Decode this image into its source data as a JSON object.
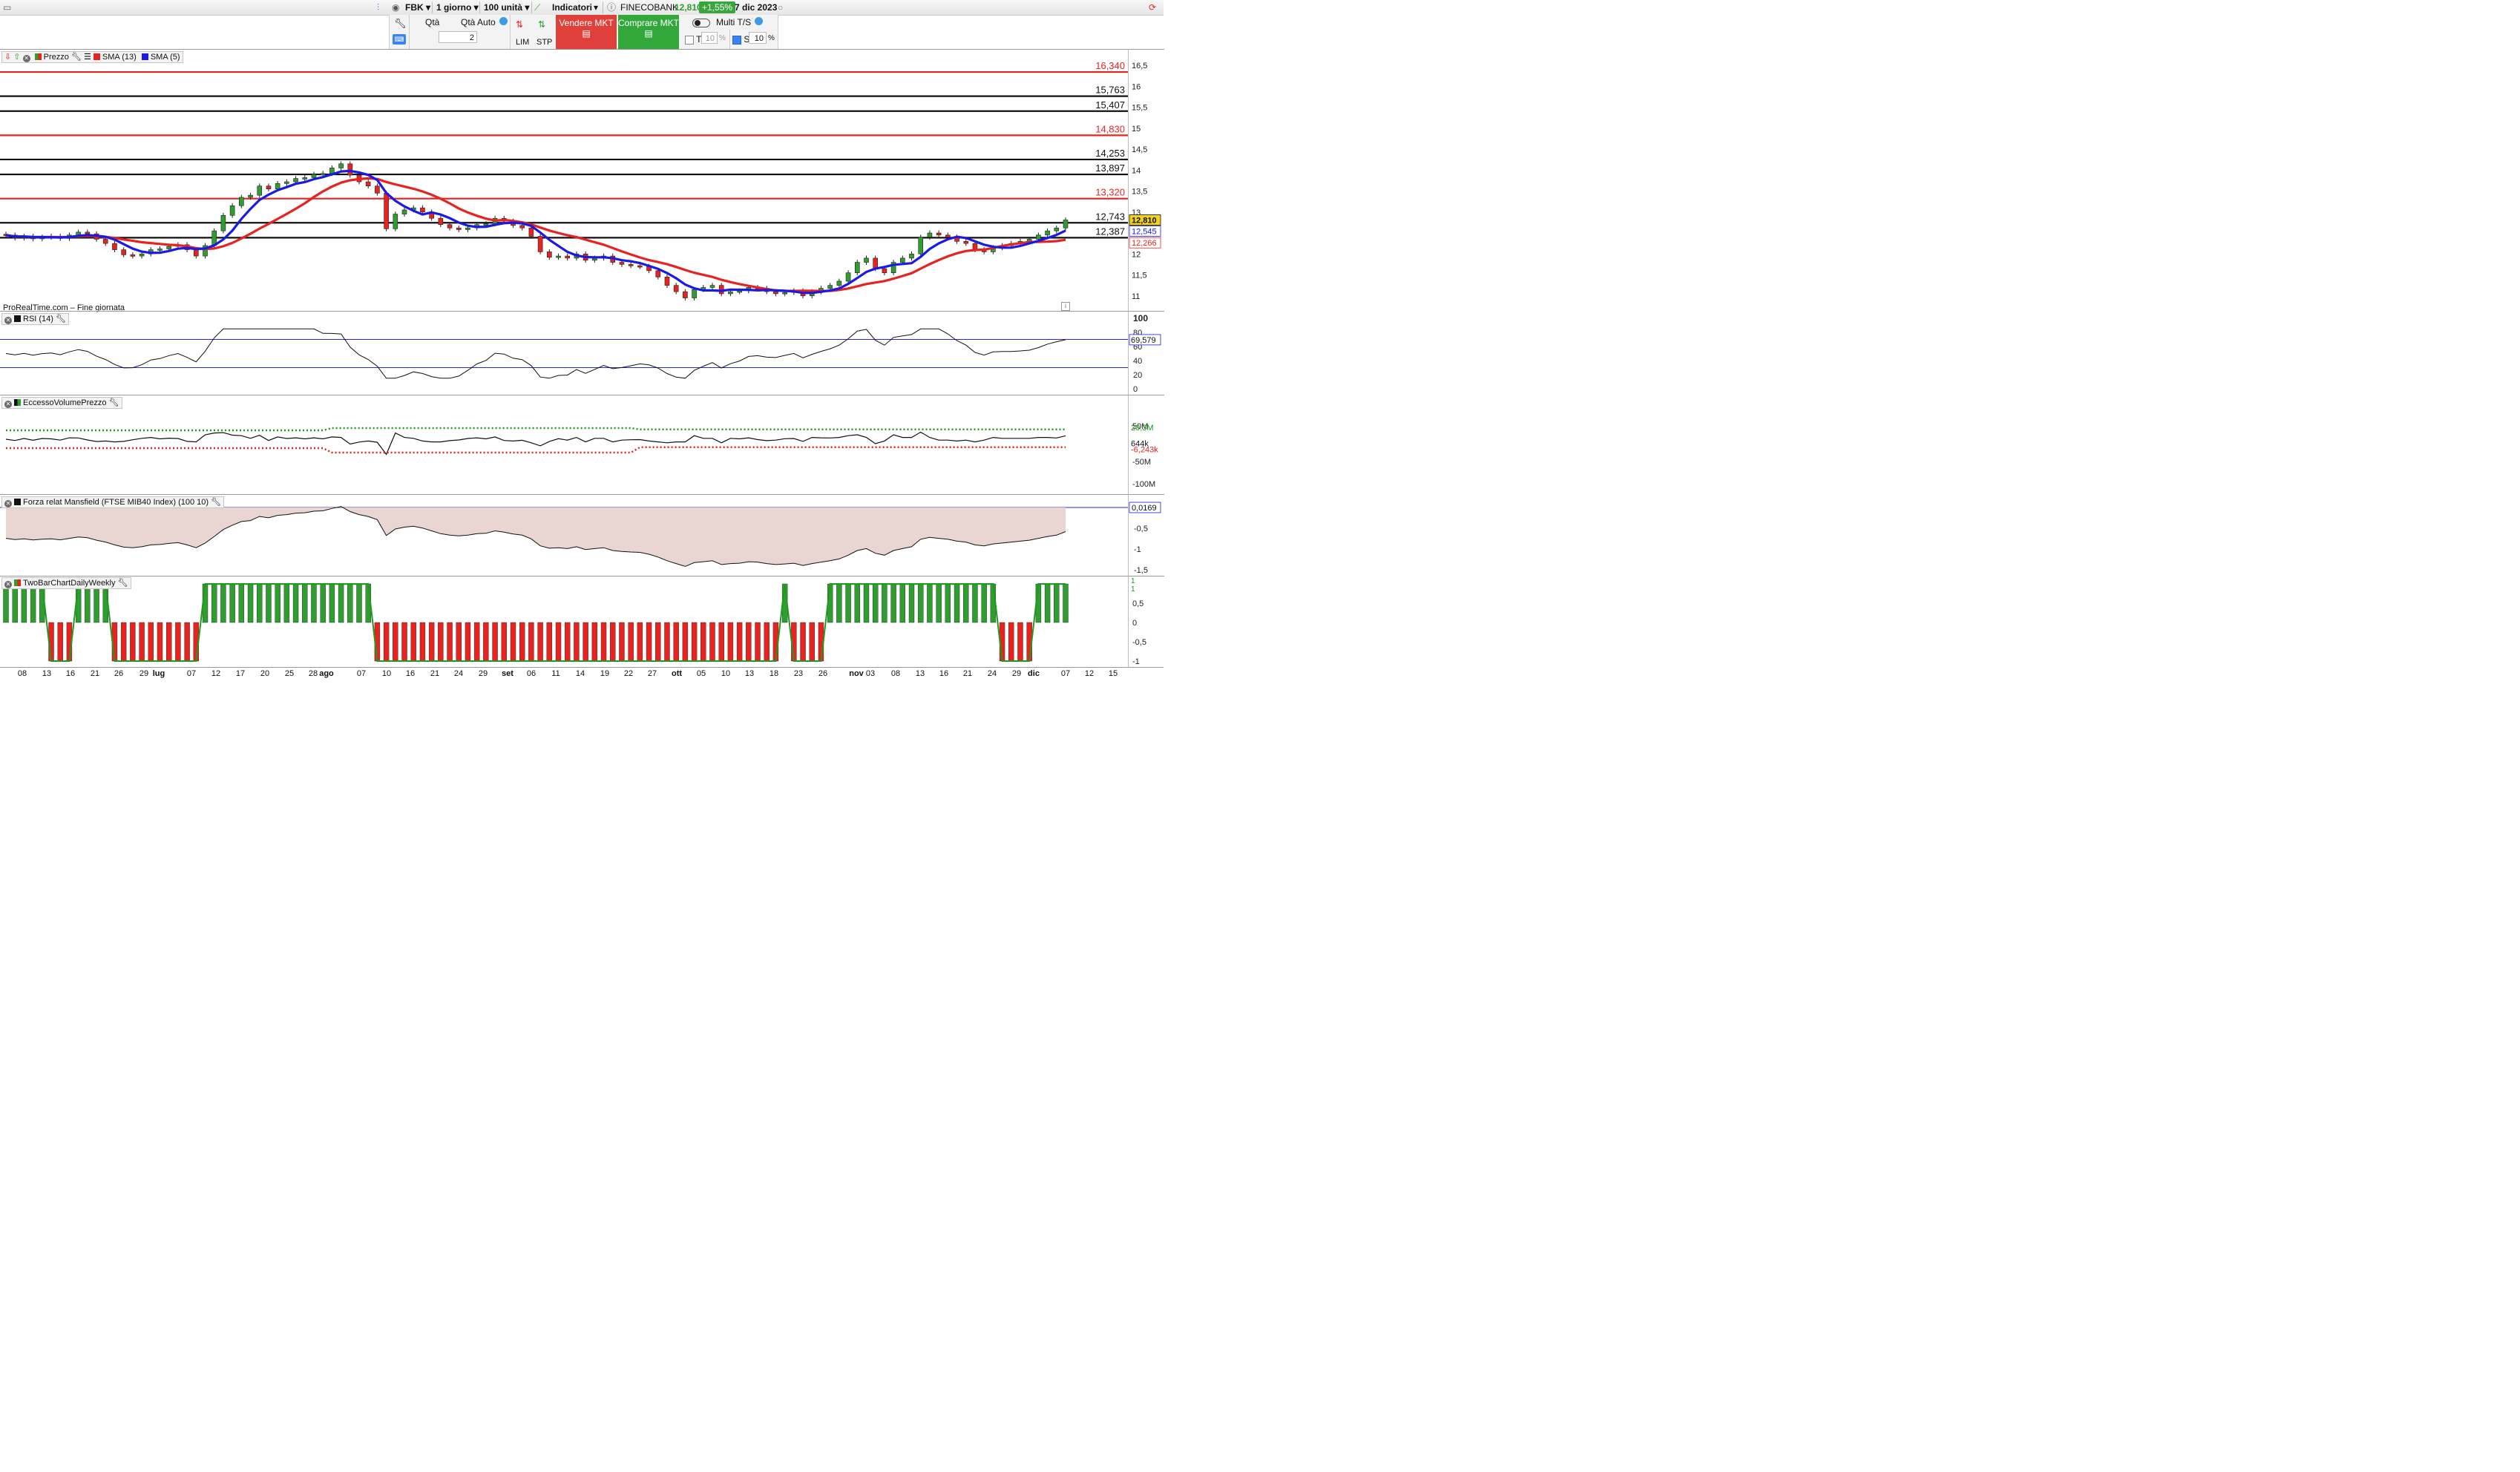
{
  "topbar": {
    "symbol": "FBK",
    "period": "1 giorno",
    "units": "100 unità",
    "indicators": "Indicatori",
    "instrument": "FINECOBANK",
    "last_price": "12,810",
    "change": "+1,55%",
    "date": "7 dic 2023"
  },
  "order_panel": {
    "qty_label": "Qtà",
    "qty_auto_label": "Qtà Auto",
    "qty_value": "2",
    "lim": "LIM",
    "stp": "STP",
    "sell": "Vendere MKT",
    "buy": "Comprare MKT",
    "multi_ts": "Multi T/S",
    "t_label": "T",
    "t_value": "10",
    "s_label": "S",
    "s_value": "10",
    "pct": "%"
  },
  "price_panel": {
    "header_title": "Prezzo",
    "sma13_label": "SMA (13)",
    "sma5_label": "SMA (5)",
    "footer": "ProRealTime.com – Fine giornata",
    "levels": [
      {
        "value": "16,340",
        "color": "#e8231f"
      },
      {
        "value": "15,763",
        "color": "#111111"
      },
      {
        "value": "15,407",
        "color": "#111111"
      },
      {
        "value": "14,830",
        "color": "#e8231f"
      },
      {
        "value": "14,253",
        "color": "#111111"
      },
      {
        "value": "13,897",
        "color": "#111111"
      },
      {
        "value": "13,320",
        "color": "#e8231f"
      },
      {
        "value": "12,743",
        "color": "#111111"
      },
      {
        "value": "12,387",
        "color": "#111111"
      }
    ],
    "y_ticks": [
      "16,5",
      "16",
      "15,5",
      "15",
      "14,5",
      "14",
      "13,5",
      "13",
      "12",
      "11,5",
      "11"
    ],
    "tags": {
      "price": "12,810",
      "sma5": "12,545",
      "sma13": "12,266"
    }
  },
  "rsi_panel": {
    "header_title": "RSI (14)",
    "y_ticks": [
      "100",
      "80",
      "60",
      "40",
      "20",
      "0"
    ],
    "value": "69,579"
  },
  "evp_panel": {
    "header_title": "EccessoVolumePrezzo",
    "y_ticks": [
      "50M",
      "-50M",
      "-100M"
    ],
    "upper_value": "20,3M",
    "value": "644k",
    "lower_value": "-6,243k"
  },
  "mansfield_panel": {
    "header_title": "Forza relat Mansfield (FTSE MIB40 Index) (100 10)",
    "y_ticks": [
      "-0,5",
      "-1",
      "-1,5"
    ],
    "value": "0,0169"
  },
  "twobar_panel": {
    "header_title": "TwoBarChartDailyWeekly",
    "y_ticks": [
      "0,5",
      "0",
      "-0,5",
      "-1"
    ],
    "value_1": "1",
    "value_2": "1"
  },
  "x_axis": [
    {
      "label": "08",
      "bold": false
    },
    {
      "label": "13",
      "bold": false
    },
    {
      "label": "16",
      "bold": false
    },
    {
      "label": "21",
      "bold": false
    },
    {
      "label": "26",
      "bold": false
    },
    {
      "label": "29",
      "bold": false
    },
    {
      "label": "lug",
      "bold": true
    },
    {
      "label": "07",
      "bold": false
    },
    {
      "label": "12",
      "bold": false
    },
    {
      "label": "17",
      "bold": false
    },
    {
      "label": "20",
      "bold": false
    },
    {
      "label": "25",
      "bold": false
    },
    {
      "label": "28",
      "bold": false
    },
    {
      "label": "ago",
      "bold": true
    },
    {
      "label": "07",
      "bold": false
    },
    {
      "label": "10",
      "bold": false
    },
    {
      "label": "16",
      "bold": false
    },
    {
      "label": "21",
      "bold": false
    },
    {
      "label": "24",
      "bold": false
    },
    {
      "label": "29",
      "bold": false
    },
    {
      "label": "set",
      "bold": true
    },
    {
      "label": "06",
      "bold": false
    },
    {
      "label": "11",
      "bold": false
    },
    {
      "label": "14",
      "bold": false
    },
    {
      "label": "19",
      "bold": false
    },
    {
      "label": "22",
      "bold": false
    },
    {
      "label": "27",
      "bold": false
    },
    {
      "label": "ott",
      "bold": true
    },
    {
      "label": "05",
      "bold": false
    },
    {
      "label": "10",
      "bold": false
    },
    {
      "label": "13",
      "bold": false
    },
    {
      "label": "18",
      "bold": false
    },
    {
      "label": "23",
      "bold": false
    },
    {
      "label": "26",
      "bold": false
    },
    {
      "label": "nov",
      "bold": true
    },
    {
      "label": "03",
      "bold": false
    },
    {
      "label": "08",
      "bold": false
    },
    {
      "label": "13",
      "bold": false
    },
    {
      "label": "16",
      "bold": false
    },
    {
      "label": "21",
      "bold": false
    },
    {
      "label": "24",
      "bold": false
    },
    {
      "label": "29",
      "bold": false
    },
    {
      "label": "dic",
      "bold": true
    },
    {
      "label": "07",
      "bold": false
    },
    {
      "label": "12",
      "bold": false
    },
    {
      "label": "15",
      "bold": false
    }
  ],
  "colors": {
    "up": "#2e9e2e",
    "down": "#e8231f",
    "sma5": "#1a1ae6",
    "sma13": "#e8231f",
    "rsi_band": "#2a2ad0",
    "evp_upper": "#1f9a1f",
    "evp_lower": "#e8231f",
    "mansfield_fill": "#e9d6d3"
  },
  "chart_data": {
    "type": "line",
    "title": "FINECOBANK",
    "closes": [
      12.45,
      12.38,
      12.42,
      12.36,
      12.4,
      12.42,
      12.37,
      12.45,
      12.52,
      12.48,
      12.35,
      12.25,
      12.1,
      11.98,
      11.95,
      12.0,
      12.1,
      12.12,
      12.18,
      12.22,
      12.1,
      11.95,
      12.2,
      12.55,
      12.92,
      13.15,
      13.35,
      13.4,
      13.62,
      13.55,
      13.68,
      13.72,
      13.8,
      13.82,
      13.9,
      13.92,
      14.05,
      14.15,
      13.88,
      13.72,
      13.62,
      13.45,
      12.6,
      12.95,
      13.05,
      13.1,
      13.0,
      12.85,
      12.7,
      12.62,
      12.58,
      12.62,
      12.7,
      12.72,
      12.85,
      12.78,
      12.68,
      12.62,
      12.42,
      12.05,
      11.92,
      11.95,
      11.9,
      12.0,
      11.85,
      11.9,
      11.95,
      11.8,
      11.75,
      11.72,
      11.7,
      11.6,
      11.45,
      11.25,
      11.1,
      10.95,
      11.15,
      11.2,
      11.25,
      11.05,
      11.1,
      11.12,
      11.2,
      11.18,
      11.1,
      11.05,
      11.08,
      11.12,
      11.0,
      11.1,
      11.18,
      11.25,
      11.35,
      11.55,
      11.8,
      11.9,
      11.65,
      11.55,
      11.8,
      11.9,
      12.0,
      12.4,
      12.5,
      12.45,
      12.4,
      12.3,
      12.25,
      12.1,
      12.05,
      12.15,
      12.2,
      12.25,
      12.3,
      12.35,
      12.45,
      12.55,
      12.62,
      12.81
    ],
    "sma5_last": 12.545,
    "sma13_last": 12.266,
    "last": 12.81,
    "ylim": [
      10.5,
      16.5
    ]
  }
}
